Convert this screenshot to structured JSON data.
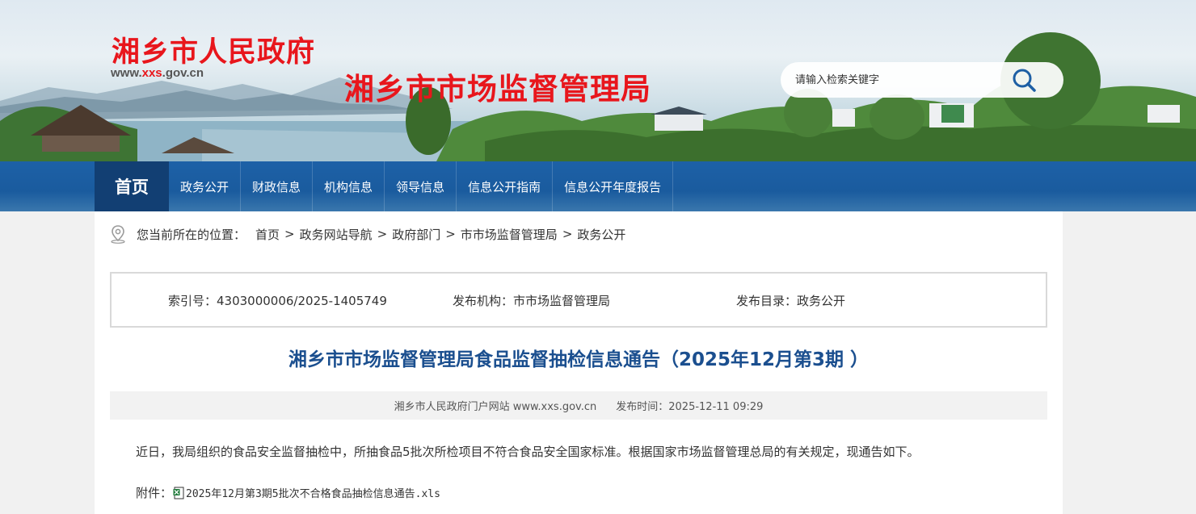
{
  "header": {
    "site_title": "湘乡市人民政府",
    "site_url_prefix": "www.",
    "site_url_highlight": "xxs",
    "site_url_suffix": ".gov.cn",
    "dept_title": "湘乡市市场监督管理局",
    "search_placeholder": "请输入检索关键字"
  },
  "nav": {
    "home": "首页",
    "items": [
      "政务公开",
      "财政信息",
      "机构信息",
      "领导信息",
      "信息公开指南",
      "信息公开年度报告"
    ]
  },
  "breadcrumb": {
    "label": "您当前所在的位置：",
    "items": [
      "首页",
      "政务网站导航",
      "政府部门",
      "市市场监督管理局",
      "政务公开"
    ],
    "separator": ">"
  },
  "meta": {
    "index_no": "索引号：4303000006/2025-1405749",
    "publisher": "发布机构：市市场监督管理局",
    "category": "发布目录：政务公开"
  },
  "article": {
    "title": "湘乡市市场监督管理局食品监督抽检信息通告（2025年12月第3期 ）",
    "source": "湘乡市人民政府门户网站 www.xxs.gov.cn",
    "publish_time": "发布时间：2025-12-11 09:29",
    "paragraph": "近日，我局组织的食品安全监督抽检中，所抽食品5批次所检项目不符合食品安全国家标准。根据国家市场监督管理总局的有关规定，现通告如下。",
    "attachment_label": "附件：",
    "attachment_file": "2025年12月第3期5批次不合格食品抽检信息通告.xls"
  },
  "colors": {
    "title_red": "#e8161c",
    "nav_blue": "#1d61a7",
    "nav_home": "#123f73",
    "article_title": "#1b4f8f"
  },
  "icons": [
    "search-icon",
    "location-pin-icon",
    "xls-file-icon"
  ]
}
